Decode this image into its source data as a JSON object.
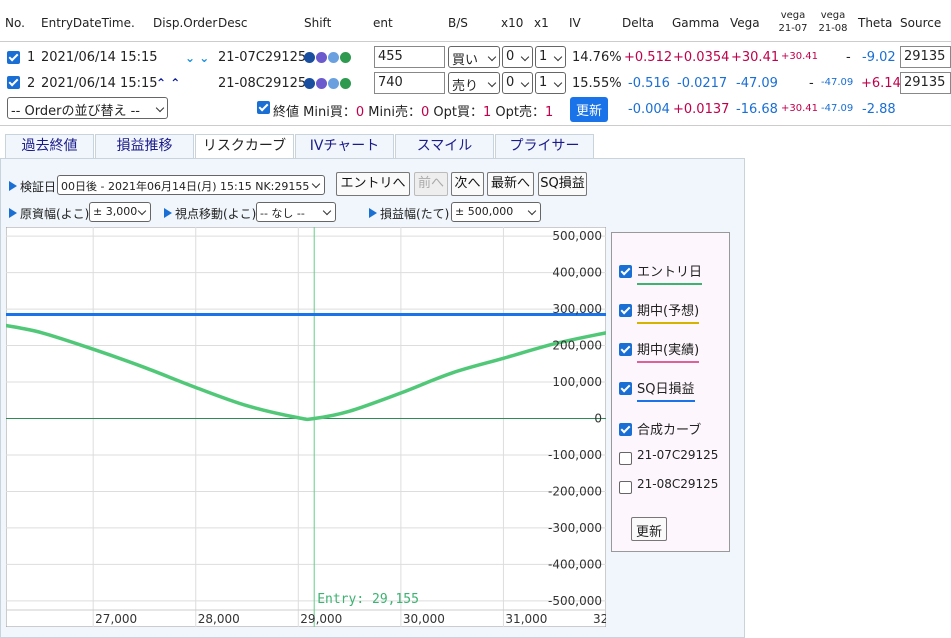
{
  "table": {
    "headers": {
      "no": "No.",
      "entry": "EntryDateTime.",
      "disp": "Disp.Order",
      "desc": "Desc",
      "shift": "Shift",
      "ent": "ent",
      "bs": "B/S",
      "x10": "x10",
      "x1": "x1",
      "iv": "IV",
      "delta": "Delta",
      "gamma": "Gamma",
      "vega": "Vega",
      "vega1_top": "vega",
      "vega1_bot": "21-07",
      "vega2_top": "vega",
      "vega2_bot": "21-08",
      "theta": "Theta",
      "source": "Source"
    },
    "rows": [
      {
        "no": "1",
        "entry": "2021/06/14 15:15",
        "arrows": "⮟⮟",
        "desc": "21-07C29125",
        "ent": "455",
        "bs": "買い",
        "x10": "0",
        "x1": "1",
        "iv": "14.76%",
        "delta": "+0.512",
        "gamma": "+0.0354",
        "vega": "+30.41",
        "vega1": "+30.41",
        "vega2": "-",
        "theta": "-9.02",
        "source": "29135"
      },
      {
        "no": "2",
        "entry": "2021/06/14 15:15",
        "arrows": "⮝⮝",
        "desc": "21-08C29125",
        "ent": "740",
        "bs": "売り",
        "x10": "0",
        "x1": "1",
        "iv": "15.55%",
        "delta": "-0.516",
        "gamma": "-0.0217",
        "vega": "-47.09",
        "vega1": "-",
        "vega2": "-47.09",
        "theta": "+6.14",
        "source": "29135"
      }
    ],
    "summary": {
      "order_select": "-- Orderの並び替え --",
      "close_label": "終値",
      "mini_buy_label": "Mini買：",
      "mini_buy": "0",
      "mini_sell_label": "Mini売：",
      "mini_sell": "0",
      "opt_buy_label": "Opt買：",
      "opt_buy": "1",
      "opt_sell_label": "Opt売：",
      "opt_sell": "1",
      "update": "更新",
      "delta": "-0.004",
      "gamma": "+0.0137",
      "vega": "-16.68",
      "vega1": "+30.41",
      "vega2": "-47.09",
      "theta": "-2.88"
    }
  },
  "tabs": [
    "過去終値",
    "損益推移",
    "リスクカーブ",
    "IVチャート",
    "スマイル",
    "プライサー"
  ],
  "controls": {
    "verify_label": "検証日",
    "verify_value": "00日後 - 2021年06月14日(月) 15:15 NK:29155",
    "btn_entry": "エントリへ",
    "btn_prev": "前へ",
    "btn_next": "次へ",
    "btn_latest": "最新へ",
    "btn_sq": "SQ損益",
    "range_label": "原資幅(よこ)",
    "range_value": "± 3,000",
    "shift_label": "視点移動(よこ)",
    "shift_value": "-- なし --",
    "pl_label": "損益幅(たて)",
    "pl_value": "± 500,000"
  },
  "legend": {
    "items": [
      {
        "label": "エントリ日",
        "checked": true,
        "color": "#3cb371"
      },
      {
        "label": "期中(予想)",
        "checked": true,
        "color": "#d4b400"
      },
      {
        "label": "期中(実績)",
        "checked": true,
        "color": "#e0609a"
      },
      {
        "label": "SQ日損益",
        "checked": true,
        "color": "#1a73e8"
      },
      {
        "label": "合成カーブ",
        "checked": true,
        "color": ""
      },
      {
        "label": "21-07C29125",
        "checked": false,
        "color": ""
      },
      {
        "label": "21-08C29125",
        "checked": false,
        "color": ""
      }
    ],
    "update": "更新"
  },
  "chart_data": {
    "type": "line",
    "x_range": [
      26150,
      32000
    ],
    "y_range": [
      -525000,
      525000
    ],
    "x_ticks": [
      27000,
      28000,
      29000,
      30000,
      31000
    ],
    "x_tick_labels": [
      "27,000",
      "28,000",
      "29,000",
      "30,000",
      "31,000"
    ],
    "x_tick_partial": "32",
    "y_ticks": [
      500000,
      400000,
      300000,
      200000,
      100000,
      0,
      -100000,
      -200000,
      -300000,
      -400000,
      -500000
    ],
    "y_tick_labels": [
      "500,000",
      "400,000",
      "300,000",
      "200,000",
      "100,000",
      "0",
      "-100,000",
      "-200,000",
      "-300,000",
      "-400,000",
      "-500,000"
    ],
    "entry_x": 29155,
    "entry_label": "Entry: 29,155",
    "series": [
      {
        "color": "#1a73e8",
        "x": [
          26150,
          32000
        ],
        "y": [
          285000,
          285000
        ]
      },
      {
        "color": "#50c878",
        "x": [
          26150,
          26500,
          27000,
          27500,
          28000,
          28500,
          29000,
          29155,
          29500,
          30000,
          30500,
          31000,
          31500,
          32000
        ],
        "y": [
          255000,
          235000,
          190000,
          140000,
          85000,
          35000,
          2000,
          0,
          20000,
          70000,
          125000,
          165000,
          205000,
          235000
        ]
      }
    ],
    "grid": true
  }
}
